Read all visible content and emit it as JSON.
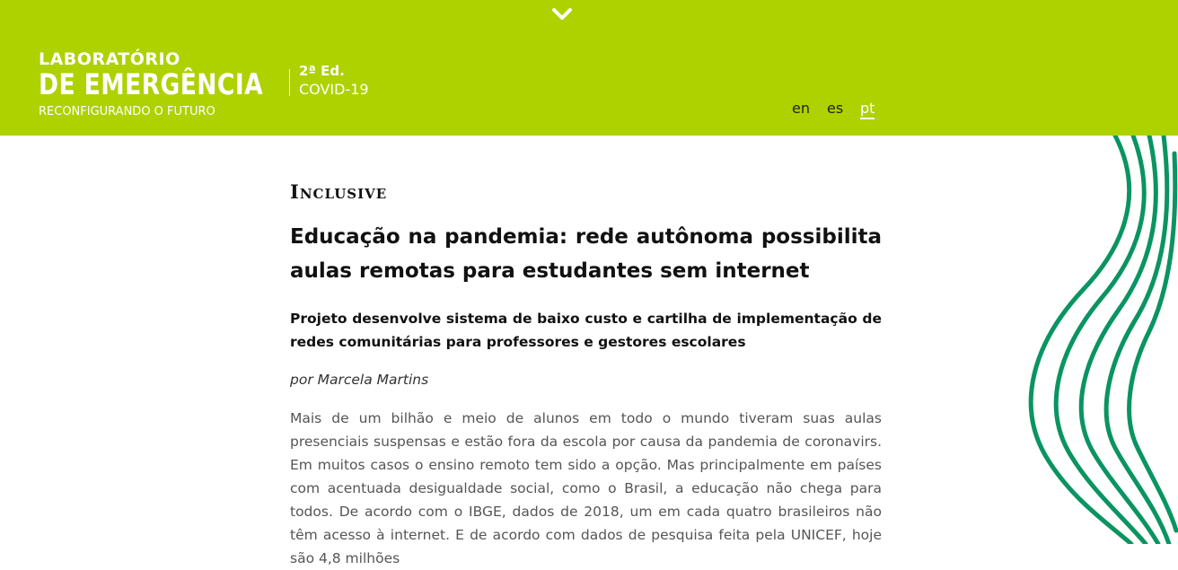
{
  "header": {
    "bg_color": "#aed100",
    "scroll_icon": "chevron-down-icon",
    "logo": {
      "line1": "LABORATÓRIO",
      "line2": "DE EMERGÊNCIA",
      "edition": "2ª Ed.",
      "covid": "COVID-19",
      "tagline": "RECONFIGURANDO O FUTURO"
    },
    "languages": [
      {
        "label": "en",
        "active": false
      },
      {
        "label": "es",
        "active": false
      },
      {
        "label": "pt",
        "active": true
      }
    ]
  },
  "article": {
    "section": "Inclusive",
    "title": "Educação na pandemia: rede autônoma possibilita aulas remotas para estudantes sem internet",
    "subtitle": "Projeto desenvolve sistema de baixo custo e cartilha de implementação de redes comunitárias para professores e gestores escolares",
    "byline": "por Marcela Martins",
    "body": "Mais de um bilhão e meio de alunos em todo o mundo tiveram suas aulas presenciais suspensas e estão fora da escola por causa da pandemia de coronavirs. Em muitos casos o ensino remoto tem sido a opção. Mas principalmente em países com acentuada desigualdade social, como o Brasil, a educação não chega para todos. De acordo com o IBGE, dados de 2018, um em cada quatro brasileiros não têm acesso à internet. E de acordo com dados de pesquisa feita pela UNICEF, hoje são 4,8 milhões"
  },
  "decoration": {
    "color": "#0a9462",
    "icon": "wavy-lines-decoration"
  }
}
